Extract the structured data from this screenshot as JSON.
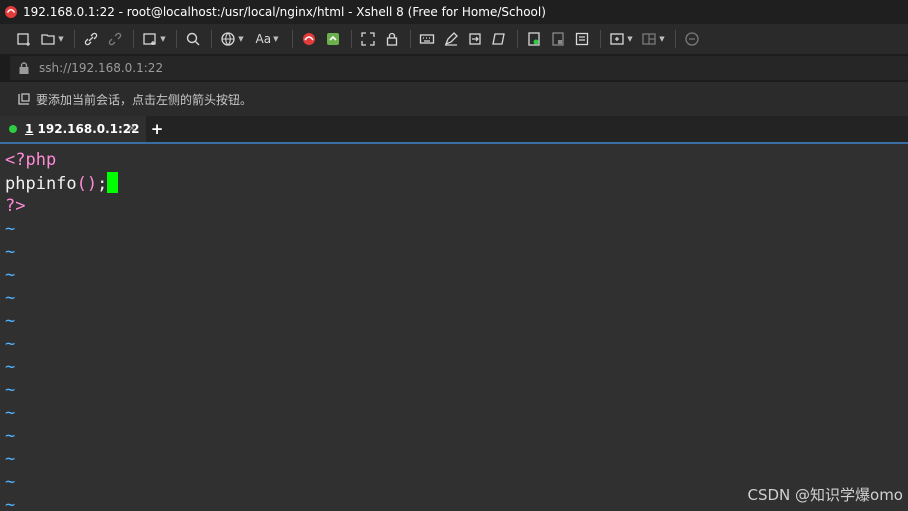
{
  "window": {
    "title": "192.168.0.1:22 - root@localhost:/usr/local/nginx/html - Xshell 8 (Free for Home/School)"
  },
  "toolbar": {
    "font_button_label": "Aa"
  },
  "address": {
    "url": "ssh://192.168.0.1:22"
  },
  "hint": {
    "text": "要添加当前会话，点击左侧的箭头按钮。"
  },
  "tabs": [
    {
      "number": "1",
      "label": " 192.168.0.1:22",
      "close": "×",
      "status_color": "#2ecc40"
    }
  ],
  "new_tab_label": "+",
  "terminal": {
    "lines": [
      {
        "segments": [
          {
            "text": "<?php",
            "color": "pink"
          }
        ]
      },
      {
        "segments": [
          {
            "text": "phpinfo",
            "color": "white"
          },
          {
            "text": "()",
            "color": "pink"
          },
          {
            "text": ";",
            "color": "white"
          }
        ],
        "cursor": true
      },
      {
        "segments": [
          {
            "text": "?>",
            "color": "pink"
          }
        ]
      }
    ],
    "tilde_count": 13,
    "tilde_char": "~",
    "cursor_color": "#00ff00"
  },
  "watermark": "CSDN @知识学爆omo",
  "colors": {
    "pink": "#ff8bd8",
    "tilde": "#4fb3ff",
    "background": "#303030"
  }
}
